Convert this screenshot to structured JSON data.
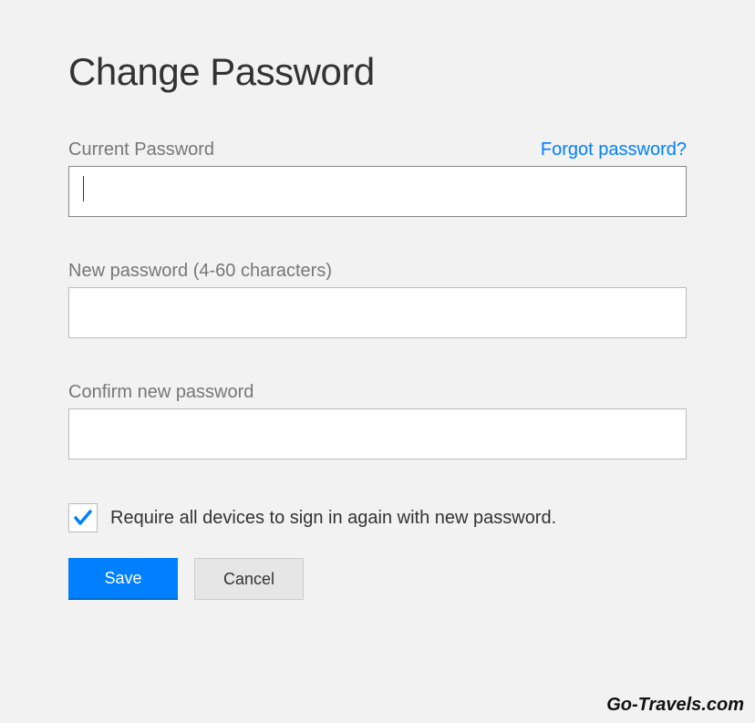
{
  "title": "Change Password",
  "fields": {
    "current": {
      "label": "Current Password",
      "value": ""
    },
    "new": {
      "label": "New password (4-60 characters)",
      "value": ""
    },
    "confirm": {
      "label": "Confirm new password",
      "value": ""
    }
  },
  "forgot_link": "Forgot password?",
  "checkbox": {
    "label": "Require all devices to sign in again with new password.",
    "checked": true
  },
  "buttons": {
    "save": "Save",
    "cancel": "Cancel"
  },
  "watermark": "Go-Travels.com"
}
